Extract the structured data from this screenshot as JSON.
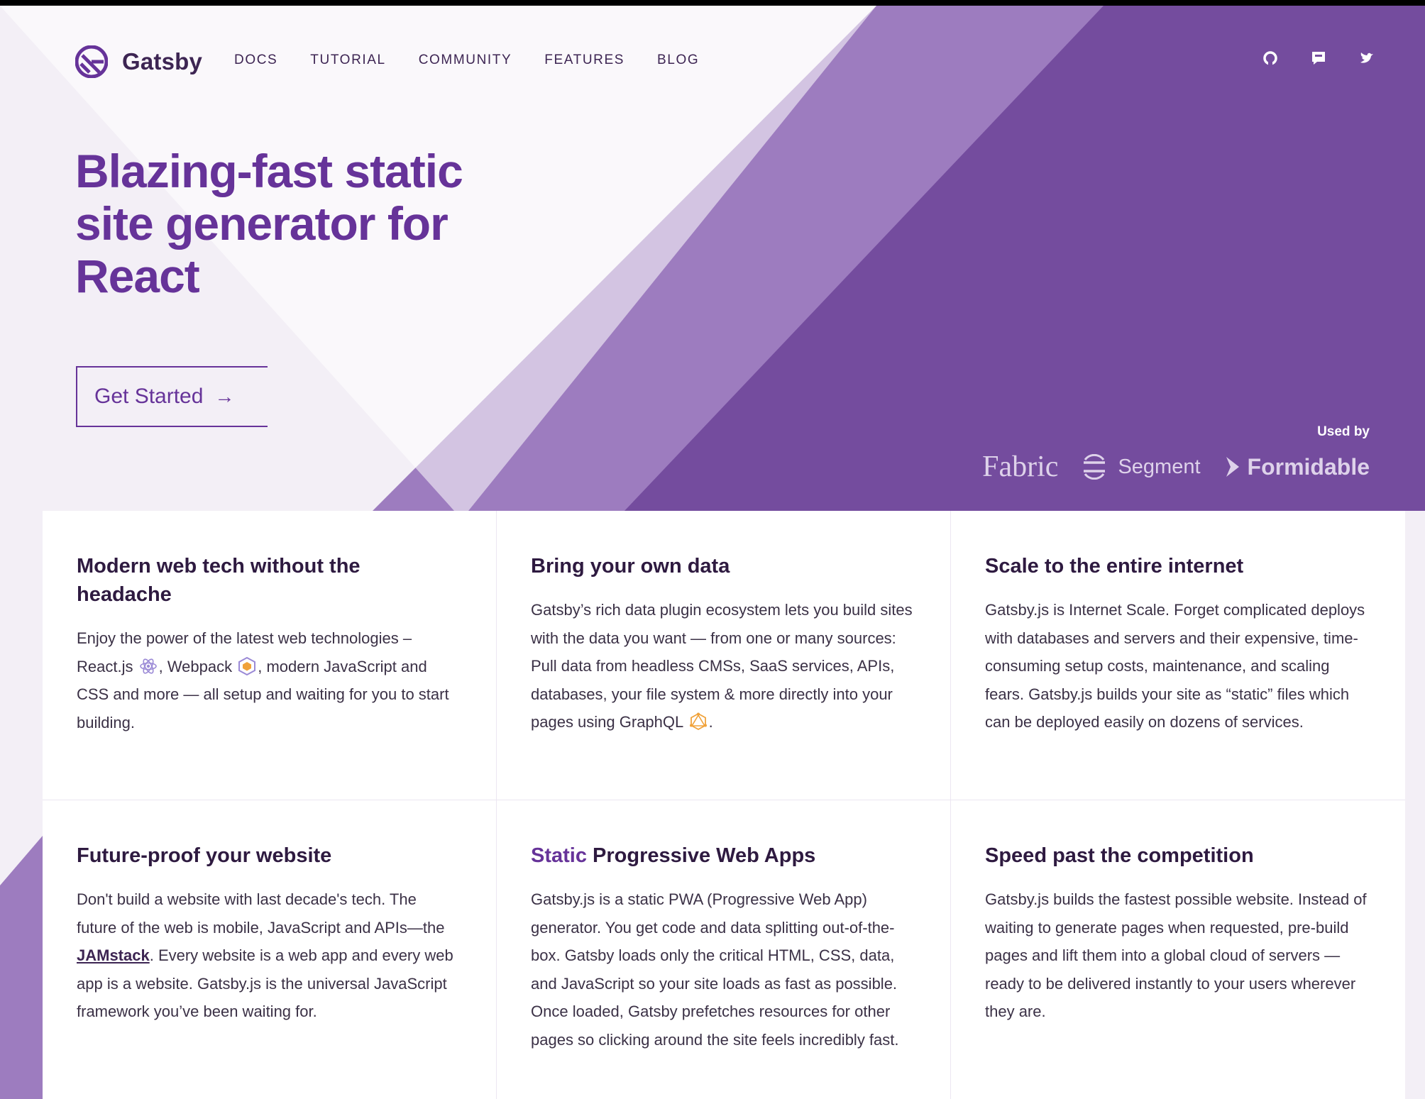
{
  "colors": {
    "brand": "#663399",
    "brand_light": "#9d7cbf",
    "brand_dark": "#744c9e",
    "bg": "#f3eff6"
  },
  "header": {
    "logo_text": "Gatsby",
    "nav": [
      "DOCS",
      "TUTORIAL",
      "COMMUNITY",
      "FEATURES",
      "BLOG"
    ],
    "social_icons": [
      "github-icon",
      "discord-icon",
      "twitter-icon"
    ]
  },
  "hero": {
    "title": "Blazing-fast static site generator for React",
    "cta_label": "Get Started",
    "cta_arrow": "→"
  },
  "used_by": {
    "label": "Used by",
    "brands": [
      "Fabric",
      "Segment",
      "Formidable"
    ]
  },
  "features": [
    {
      "title": "Modern web tech without the headache",
      "body_pre": "Enjoy the power of the latest web technologies – React.js ",
      "body_mid": ", Webpack ",
      "body_post": ", modern JavaScript and CSS and more — all setup and waiting for you to start building."
    },
    {
      "title": "Bring your own data",
      "body_pre": "Gatsby’s rich data plugin ecosystem lets you build sites with the data you want — from one or many sources: Pull data from headless CMSs, SaaS services, APIs, databases, your file system & more directly into your pages using GraphQL ",
      "body_post": "."
    },
    {
      "title": "Scale to the entire internet",
      "body": "Gatsby.js is Internet Scale. Forget complicated deploys with databases and servers and their expensive, time-consuming setup costs, maintenance, and scaling fears. Gatsby.js builds your site as “static” files which can be deployed easily on dozens of services."
    },
    {
      "title": "Future-proof your website",
      "body_pre": "Don't build a website with last decade's tech. The future of the web is mobile, JavaScript and APIs—the ",
      "link": "JAMstack",
      "body_post": ". Every website is a web app and every web app is a website. Gatsby.js is the universal JavaScript framework you’ve been waiting for."
    },
    {
      "title_highlight": "Static",
      "title_rest": " Progressive Web Apps",
      "body": "Gatsby.js is a static PWA (Progressive Web App) generator. You get code and data splitting out-of-the-box. Gatsby loads only the critical HTML, CSS, data, and JavaScript so your site loads as fast as possible. Once loaded, Gatsby prefetches resources for other pages so clicking around the site feels incredibly fast."
    },
    {
      "title": "Speed past the competition",
      "body": "Gatsby.js builds the fastest possible website. Instead of waiting to generate pages when requested, pre-build pages and lift them into a global cloud of servers — ready to be delivered instantly to your users wherever they are."
    }
  ]
}
